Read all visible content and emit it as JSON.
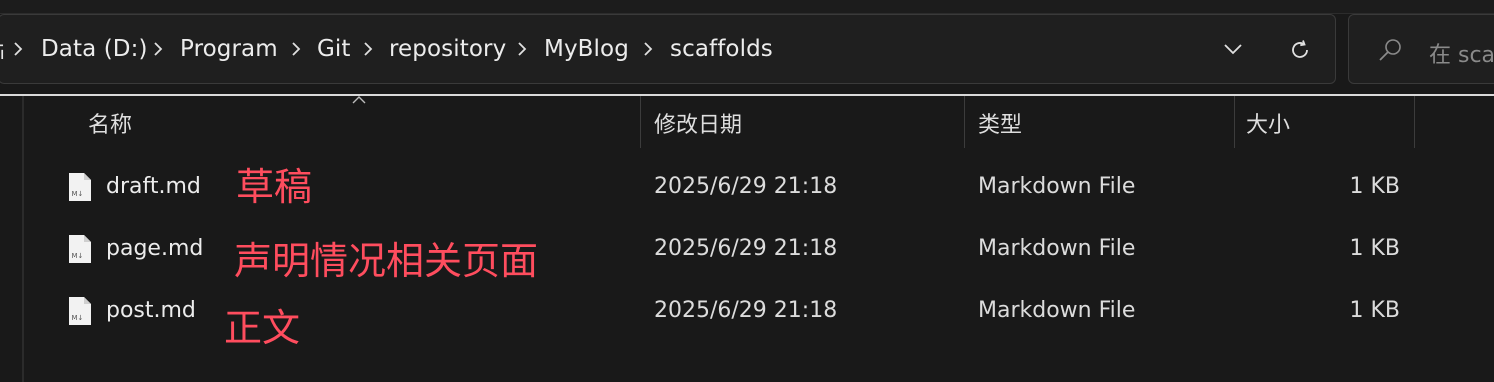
{
  "breadcrumb": {
    "clipped_prefix": "画",
    "items": [
      "Data (D:)",
      "Program",
      "Git",
      "repository",
      "MyBlog",
      "scaffolds"
    ]
  },
  "search": {
    "placeholder": "在 sca"
  },
  "columns": {
    "name": "名称",
    "modified": "修改日期",
    "type": "类型",
    "size": "大小"
  },
  "files": [
    {
      "name": "draft.md",
      "modified": "2025/6/29 21:18",
      "type": "Markdown File",
      "size": "1 KB",
      "note": "草稿"
    },
    {
      "name": "page.md",
      "modified": "2025/6/29 21:18",
      "type": "Markdown File",
      "size": "1 KB",
      "note": "声明情况相关页面"
    },
    {
      "name": "post.md",
      "modified": "2025/6/29 21:18",
      "type": "Markdown File",
      "size": "1 KB",
      "note": "正文"
    }
  ],
  "colors": {
    "background": "#191919",
    "annotation": "#ff4d5e",
    "nav_line": "#d9d9d9"
  },
  "icons": [
    "chevron-right-icon",
    "chevron-down-icon",
    "refresh-icon",
    "search-icon",
    "markdown-file-icon",
    "sort-caret-icon"
  ]
}
